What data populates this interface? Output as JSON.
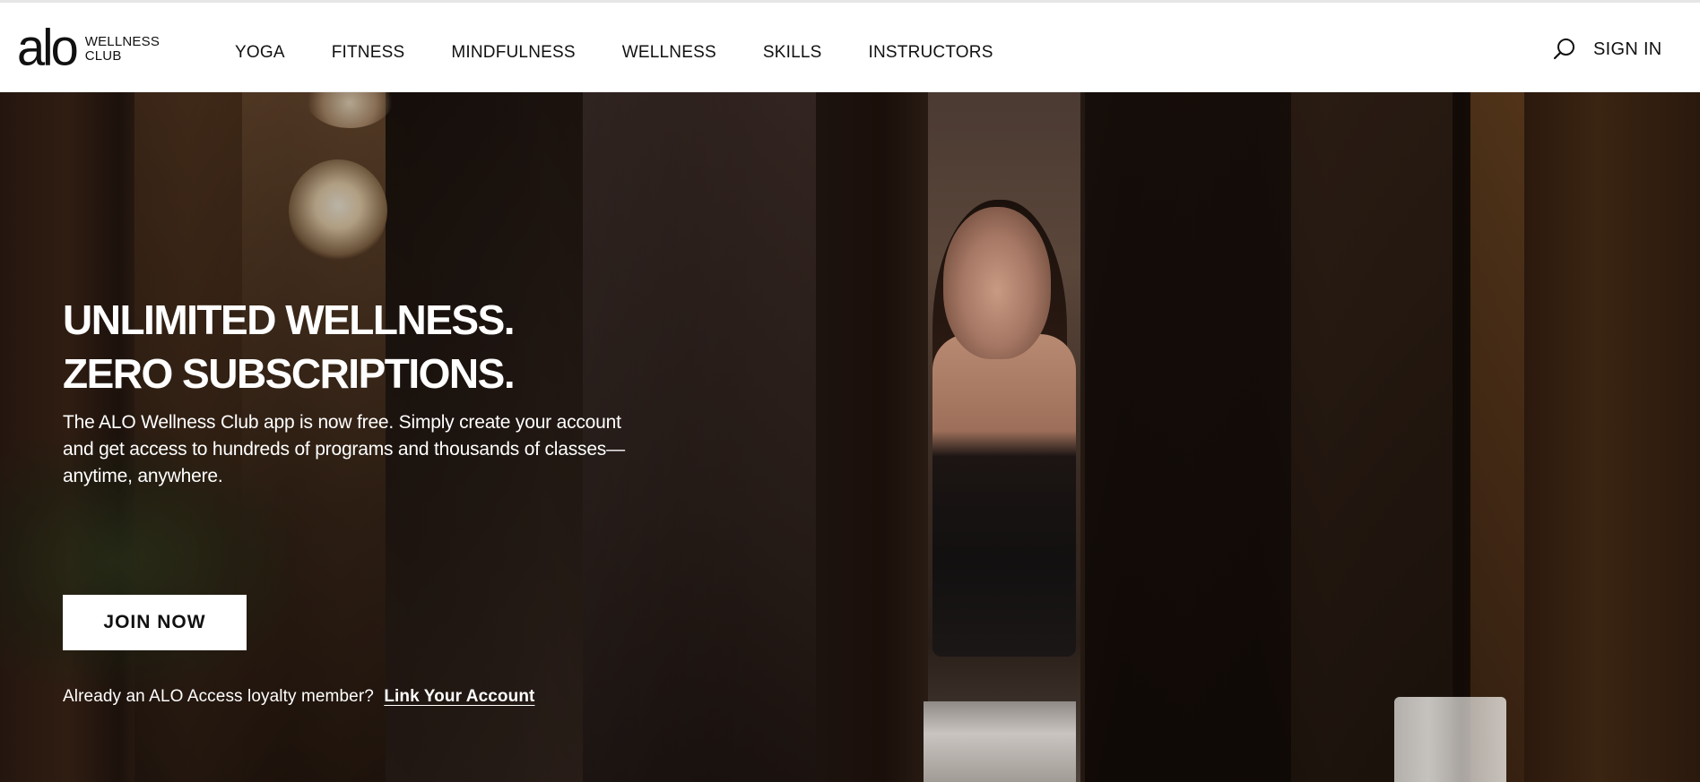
{
  "header": {
    "logo": {
      "mark": "alo",
      "line1": "WELLNESS",
      "line2": "CLUB"
    },
    "nav": [
      "YOGA",
      "FITNESS",
      "MINDFULNESS",
      "WELLNESS",
      "SKILLS",
      "INSTRUCTORS"
    ],
    "search_icon": "search-icon",
    "signin_label": "SIGN IN"
  },
  "hero": {
    "headline_line1": "UNLIMITED WELLNESS.",
    "headline_line2": "ZERO SUBSCRIPTIONS.",
    "lead": "The ALO Wellness Club app is now free. Simply create your account and get access to hundreds of programs and thousands of classes—anytime, anywhere.",
    "cta_label": "JOIN NOW",
    "loyalty_prompt": "Already an ALO Access loyalty member?",
    "loyalty_link": "Link Your Account"
  },
  "colors": {
    "text": "#111111",
    "background": "#ffffff",
    "hero_text": "#ffffff"
  }
}
